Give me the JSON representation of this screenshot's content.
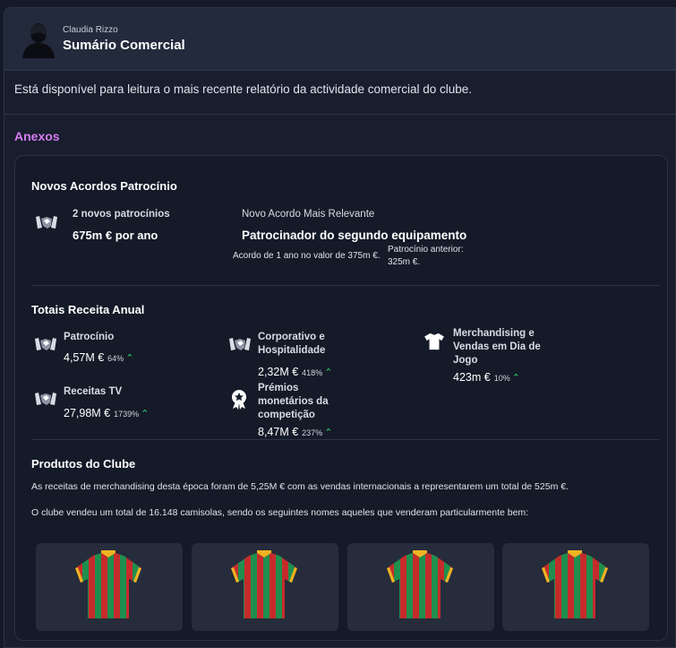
{
  "header": {
    "sender": "Claudia Rizzo",
    "title": "Sumário Comercial"
  },
  "intro": "Está disponível para leitura o mais recente relatório da actividade comercial do clube.",
  "attachments_label": "Anexos",
  "sponsorship": {
    "title": "Novos Acordos Patrocínio",
    "new_count": "2 novos patrocínios",
    "per_year": "675m € por ano",
    "relevant_label": "Novo Acordo Mais Relevante",
    "relevant_name": "Patrocinador do segundo equipamento",
    "deal_terms": "Acordo de 1 ano no valor de 375m €.",
    "previous_line1": "Patrocínio anterior:",
    "previous_line2": "325m €."
  },
  "revenue": {
    "title": "Totais Receita Anual",
    "items": [
      {
        "label": "Patrocínio",
        "value": "4,57M €",
        "pct": "64%",
        "icon": "handshake-icon"
      },
      {
        "label": "Corporativo e Hospitalidade",
        "value": "2,32M €",
        "pct": "418%",
        "icon": "handshake-icon"
      },
      {
        "label": "Merchandising e Vendas em Dia de Jogo",
        "value": "423m €",
        "pct": "10%",
        "icon": "shirt-icon"
      },
      {
        "label": "Receitas TV",
        "value": "27,98M €",
        "pct": "1739%",
        "icon": "handshake-icon"
      },
      {
        "label": "Prémios monetários da competição",
        "value": "8,47M €",
        "pct": "237%",
        "icon": "award-icon"
      }
    ]
  },
  "products": {
    "title": "Produtos do Clube",
    "line1": "As receitas de merchandising desta época foram de 5,25M € com as vendas internacionais a representarem um total de 525m €.",
    "line2": "O clube vendeu um total de 16.148 camisolas, sendo os seguintes nomes aqueles que venderam particularmente bem:"
  },
  "colors": {
    "accent": "#d57cf0",
    "up": "#3bd06a",
    "jersey_green": "#1f8f4e",
    "jersey_red": "#c62b2b",
    "jersey_gold": "#f0b323"
  }
}
